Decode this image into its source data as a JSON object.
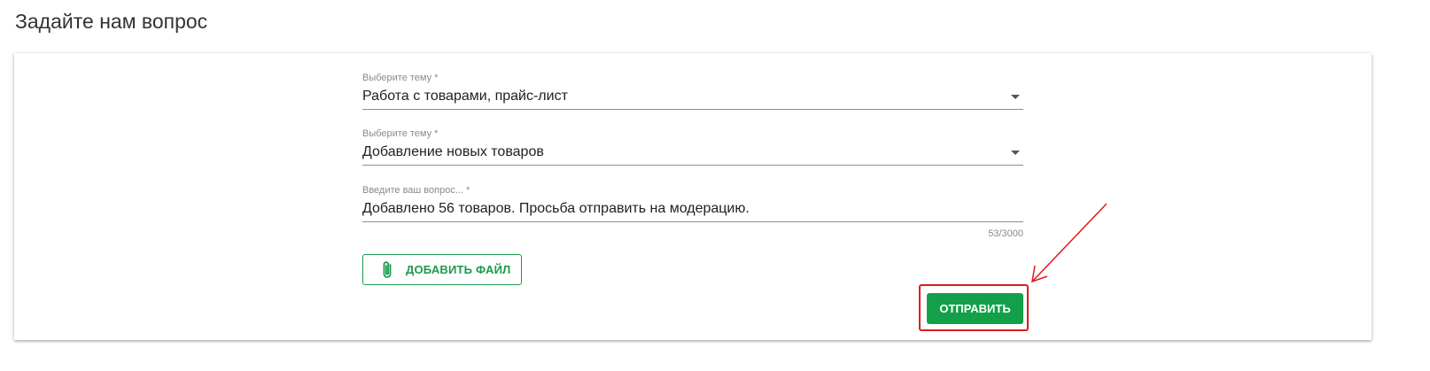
{
  "page": {
    "title": "Задайте нам вопрос"
  },
  "form": {
    "topic": {
      "label": "Выберите тему *",
      "value": "Работа с товарами, прайс-лист"
    },
    "subtopic": {
      "label": "Выберите тему *",
      "value": "Добавление новых товаров"
    },
    "question": {
      "label": "Введите ваш вопрос... *",
      "value": "Добавлено 56 товаров. Просьба отправить на модерацию.",
      "counter": "53/3000"
    },
    "add_file_label": "ДОБАВИТЬ ФАЙЛ",
    "submit_label": "ОТПРАВИТЬ"
  },
  "icons": {
    "dropdown": "caret-down-icon",
    "attach": "paperclip-icon"
  },
  "colors": {
    "accent": "#12a14a",
    "outline_accent": "#1c9a4c",
    "annotation": "#e0191d"
  }
}
